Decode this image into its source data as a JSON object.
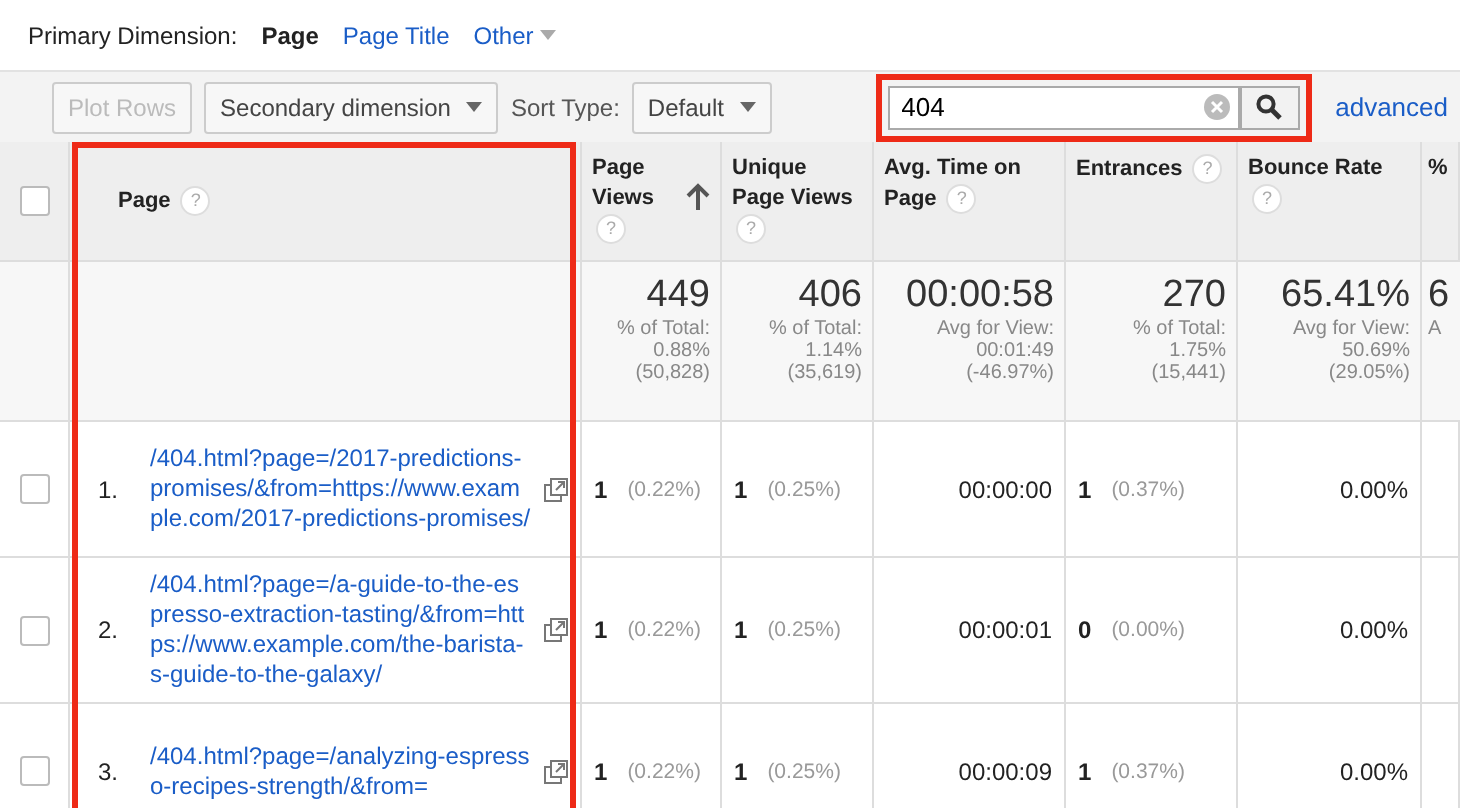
{
  "primary_dimension": {
    "label": "Primary Dimension:",
    "options": [
      {
        "label": "Page",
        "selected": true,
        "kind": "link"
      },
      {
        "label": "Page Title",
        "selected": false,
        "kind": "link"
      },
      {
        "label": "Other",
        "selected": false,
        "kind": "dropdown"
      }
    ]
  },
  "toolbar": {
    "plot_rows": {
      "label": "Plot Rows",
      "disabled": true
    },
    "secondary_dimension": "Secondary dimension",
    "sort_label": "Sort Type:",
    "sort_value": "Default",
    "search": {
      "value": "404",
      "highlighted": true
    },
    "advanced": "advanced"
  },
  "table": {
    "all_checked": false,
    "page_column_highlighted": true,
    "columns": [
      {
        "label": "Page",
        "help": "?",
        "sorted": false
      },
      {
        "label": "Page Views",
        "help": "?",
        "sorted": true
      },
      {
        "label": "Unique Page Views",
        "help": "?",
        "sorted": false
      },
      {
        "label": "Avg. Time on Page",
        "help": "?",
        "sorted": false
      },
      {
        "label": "Entrances",
        "help": "?",
        "sorted": false
      },
      {
        "label": "Bounce Rate",
        "help": "?",
        "sorted": false
      },
      {
        "label": "%",
        "sorted": false
      }
    ],
    "totals": [
      {
        "value": "449",
        "lines": [
          "% of Total:",
          "0.88%",
          "(50,828)"
        ]
      },
      {
        "value": "406",
        "lines": [
          "% of Total:",
          "1.14%",
          "(35,619)"
        ]
      },
      {
        "value": "00:00:58",
        "lines": [
          "Avg for View:",
          "00:01:49",
          "(-46.97%)"
        ]
      },
      {
        "value": "270",
        "lines": [
          "% of Total:",
          "1.75%",
          "(15,441)"
        ]
      },
      {
        "value": "65.41%",
        "lines": [
          "Avg for View:",
          "50.69%",
          "(29.05%)"
        ]
      },
      {
        "value": "6",
        "lines": [
          "A"
        ]
      }
    ],
    "rows": [
      {
        "checked": false,
        "cells": [
          {
            "kind": "page",
            "index": "1.",
            "value": "/404.html?page=/2017-predictions-promises/&from=https://www.example.com/2017-predictions-promises/"
          },
          {
            "kind": "metric",
            "value": "1",
            "share": "(0.22%)"
          },
          {
            "kind": "metric",
            "value": "1",
            "share": "(0.25%)"
          },
          {
            "kind": "plain",
            "value": "00:00:00"
          },
          {
            "kind": "metric",
            "value": "1",
            "share": "(0.37%)"
          },
          {
            "kind": "plain",
            "value": "0.00%"
          }
        ]
      },
      {
        "checked": false,
        "cells": [
          {
            "kind": "page",
            "index": "2.",
            "value": "/404.html?page=/a-guide-to-the-espresso-extraction-tasting/&from=https://www.example.com/the-barista-s-guide-to-the-galaxy/"
          },
          {
            "kind": "metric",
            "value": "1",
            "share": "(0.22%)"
          },
          {
            "kind": "metric",
            "value": "1",
            "share": "(0.25%)"
          },
          {
            "kind": "plain",
            "value": "00:00:01"
          },
          {
            "kind": "metric",
            "value": "0",
            "share": "(0.00%)"
          },
          {
            "kind": "plain",
            "value": "0.00%"
          }
        ]
      },
      {
        "checked": false,
        "cells": [
          {
            "kind": "page",
            "index": "3.",
            "value": "/404.html?page=/analyzing-espresso-recipes-strength/&from="
          },
          {
            "kind": "metric",
            "value": "1",
            "share": "(0.22%)"
          },
          {
            "kind": "metric",
            "value": "1",
            "share": "(0.25%)"
          },
          {
            "kind": "plain",
            "value": "00:00:09"
          },
          {
            "kind": "metric",
            "value": "1",
            "share": "(0.37%)"
          },
          {
            "kind": "plain",
            "value": "0.00%"
          }
        ]
      }
    ]
  }
}
